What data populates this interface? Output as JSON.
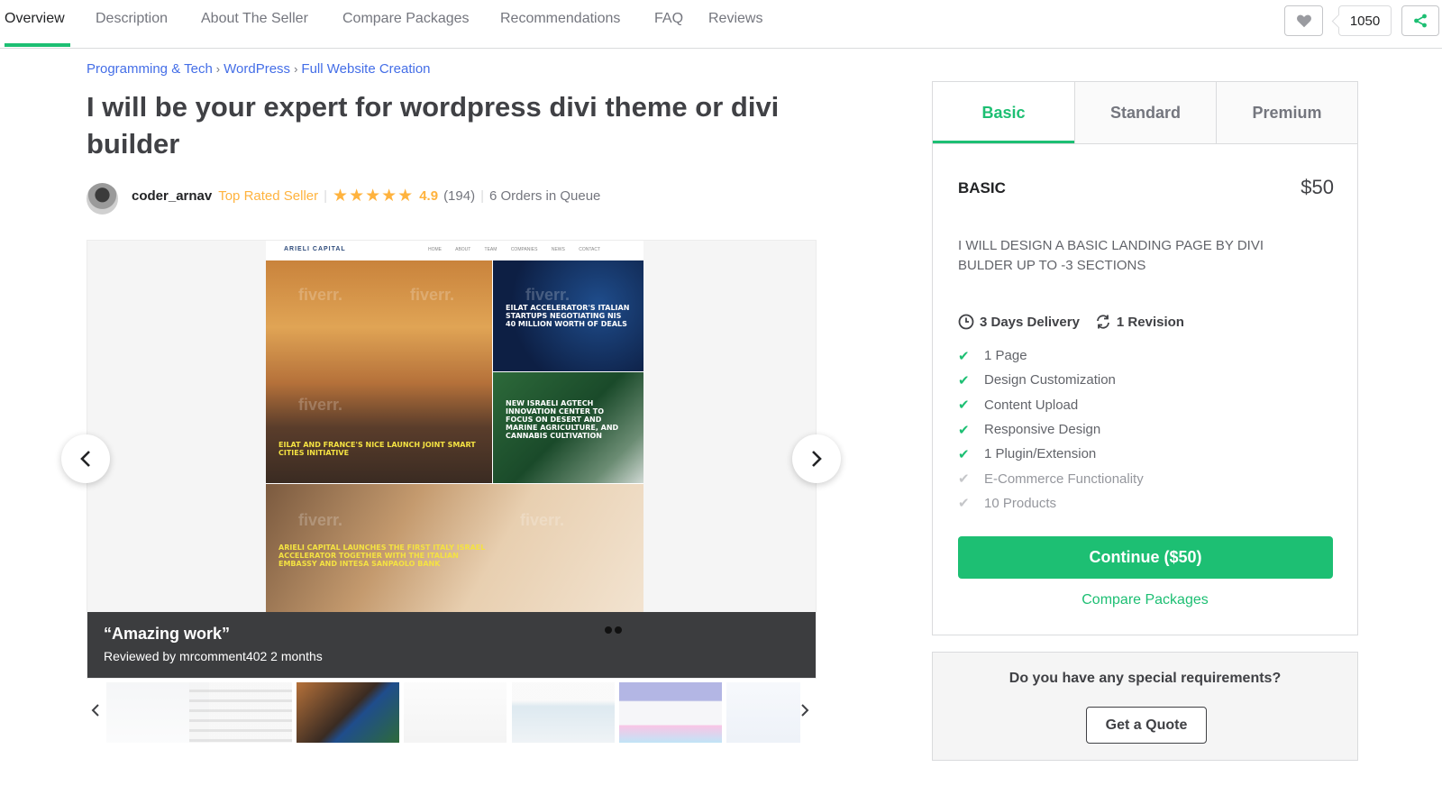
{
  "nav": {
    "tabs": [
      {
        "label": "Overview"
      },
      {
        "label": "Description"
      },
      {
        "label": "About The Seller"
      },
      {
        "label": "Compare Packages"
      },
      {
        "label": "Recommendations"
      },
      {
        "label": "FAQ"
      },
      {
        "label": "Reviews"
      }
    ],
    "active_tab": "Overview",
    "favorites_count": "1050",
    "icons": {
      "favorite": "heart-icon",
      "share": "share-icon"
    }
  },
  "breadcrumb": {
    "items": [
      "Programming & Tech",
      "WordPress",
      "Full Website Creation"
    ],
    "separator": "›"
  },
  "gig": {
    "title": "I will be your expert for wordpress divi theme or divi builder"
  },
  "seller": {
    "name": "coder_arnav",
    "level": "Top Rated Seller",
    "separator": "|",
    "stars": "★★★★★",
    "rating": "4.9",
    "reviews": "(194)",
    "queue": "6 Orders in Queue"
  },
  "gallery": {
    "preview": {
      "logo": "ARIELI CAPITAL",
      "menu": "HOME ABOUT TEAM COMPANIES NEWS CONTACT",
      "watermark": "fiverr.",
      "headlines": [
        "Eilat and France's Nice launch joint smart cities initiative",
        "Eilat accelerator's Italian startups negotiating NIS 40 million worth of deals",
        "New Israeli agtech innovation center to focus on desert and marine agriculture, and cannabis cultivation",
        "Arieli Capital launches the first Italy Israel accelerator together with the Italian Embassy and Intesa Sanpaolo Bank"
      ]
    },
    "review": {
      "quote": "“Amazing work”",
      "reviewed_by": "Reviewed by mrcomment402 2 months"
    },
    "thumbnail_count": 7,
    "active_thumbnail": 2
  },
  "package": {
    "tabs": [
      "Basic",
      "Standard",
      "Premium"
    ],
    "active_tab": "Basic",
    "name": "BASIC",
    "price": "$50",
    "description": "I WILL DESIGN A BASIC LANDING PAGE BY DIVI BULDER UP TO -3 SECTIONS",
    "delivery": "3 Days Delivery",
    "revisions": "1 Revision",
    "features": [
      {
        "label": "1 Page",
        "included": true
      },
      {
        "label": "Design Customization",
        "included": true
      },
      {
        "label": "Content Upload",
        "included": true
      },
      {
        "label": "Responsive Design",
        "included": true
      },
      {
        "label": "1 Plugin/Extension",
        "included": true
      },
      {
        "label": "E-Commerce Functionality",
        "included": false
      },
      {
        "label": "10 Products",
        "included": false
      }
    ],
    "continue_label": "Continue ($50)",
    "compare_label": "Compare Packages"
  },
  "quote": {
    "question": "Do you have any special requirements?",
    "button": "Get a Quote"
  },
  "colors": {
    "brand_green": "#1dbf73",
    "link_blue": "#446ee7",
    "star_yellow": "#ffb33e",
    "text_dark": "#404145"
  }
}
